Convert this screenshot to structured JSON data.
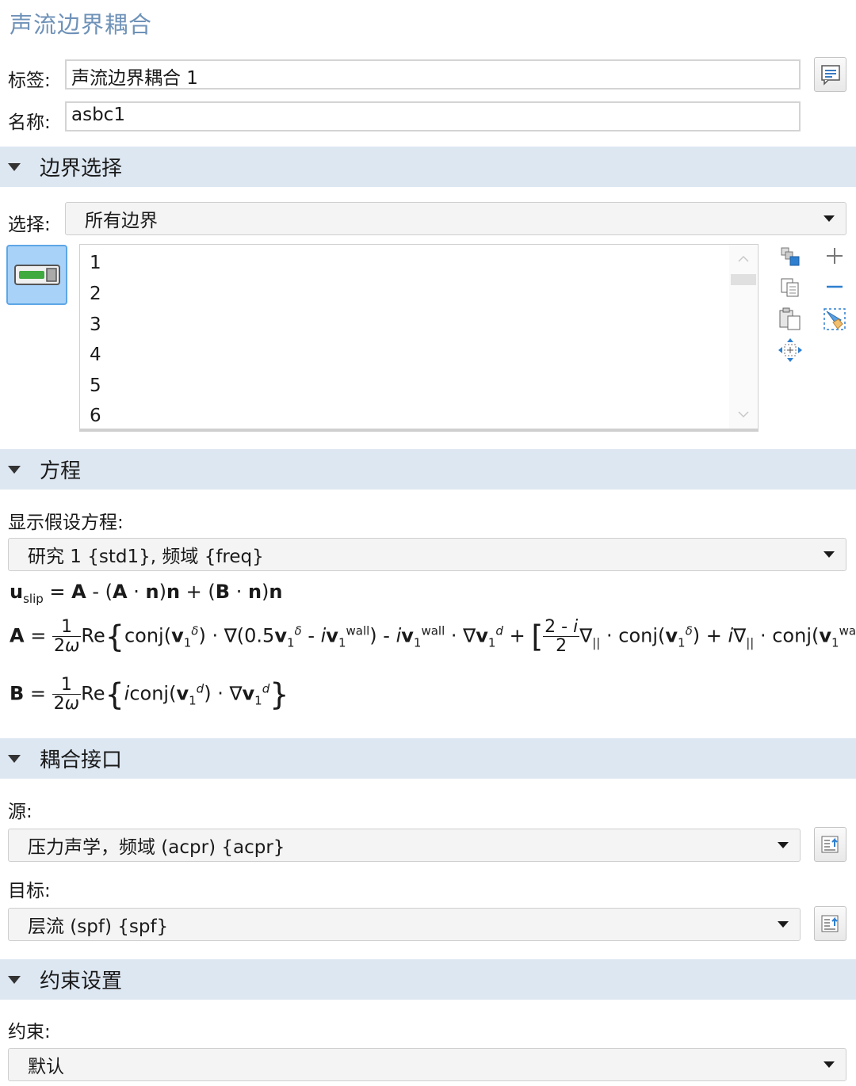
{
  "header": {
    "title": "声流边界耦合"
  },
  "general": {
    "label_caption": "标签:",
    "label_value": "声流边界耦合 1",
    "name_caption": "名称:",
    "name_value": "asbc1"
  },
  "boundary_selection": {
    "section_title": "边界选择",
    "select_caption": "选择:",
    "select_value": "所有边界",
    "items": [
      "1",
      "2",
      "3",
      "4",
      "5",
      "6"
    ]
  },
  "equation": {
    "section_title": "方程",
    "show_caption": "显示假设方程:",
    "study_value": "研究 1 {std1}, 频域 {freq}"
  },
  "coupled_interfaces": {
    "section_title": "耦合接口",
    "source_caption": "源:",
    "source_value": "压力声学，频域 (acpr) {acpr}",
    "target_caption": "目标:",
    "target_value": "层流 (spf) {spf}"
  },
  "constraint_settings": {
    "section_title": "约束设置",
    "constraint_caption": "约束:",
    "constraint_value": "默认"
  },
  "colors": {
    "section_bg": "#dde7f2",
    "title": "#6f92b8",
    "accent_green": "#3faa3f"
  }
}
